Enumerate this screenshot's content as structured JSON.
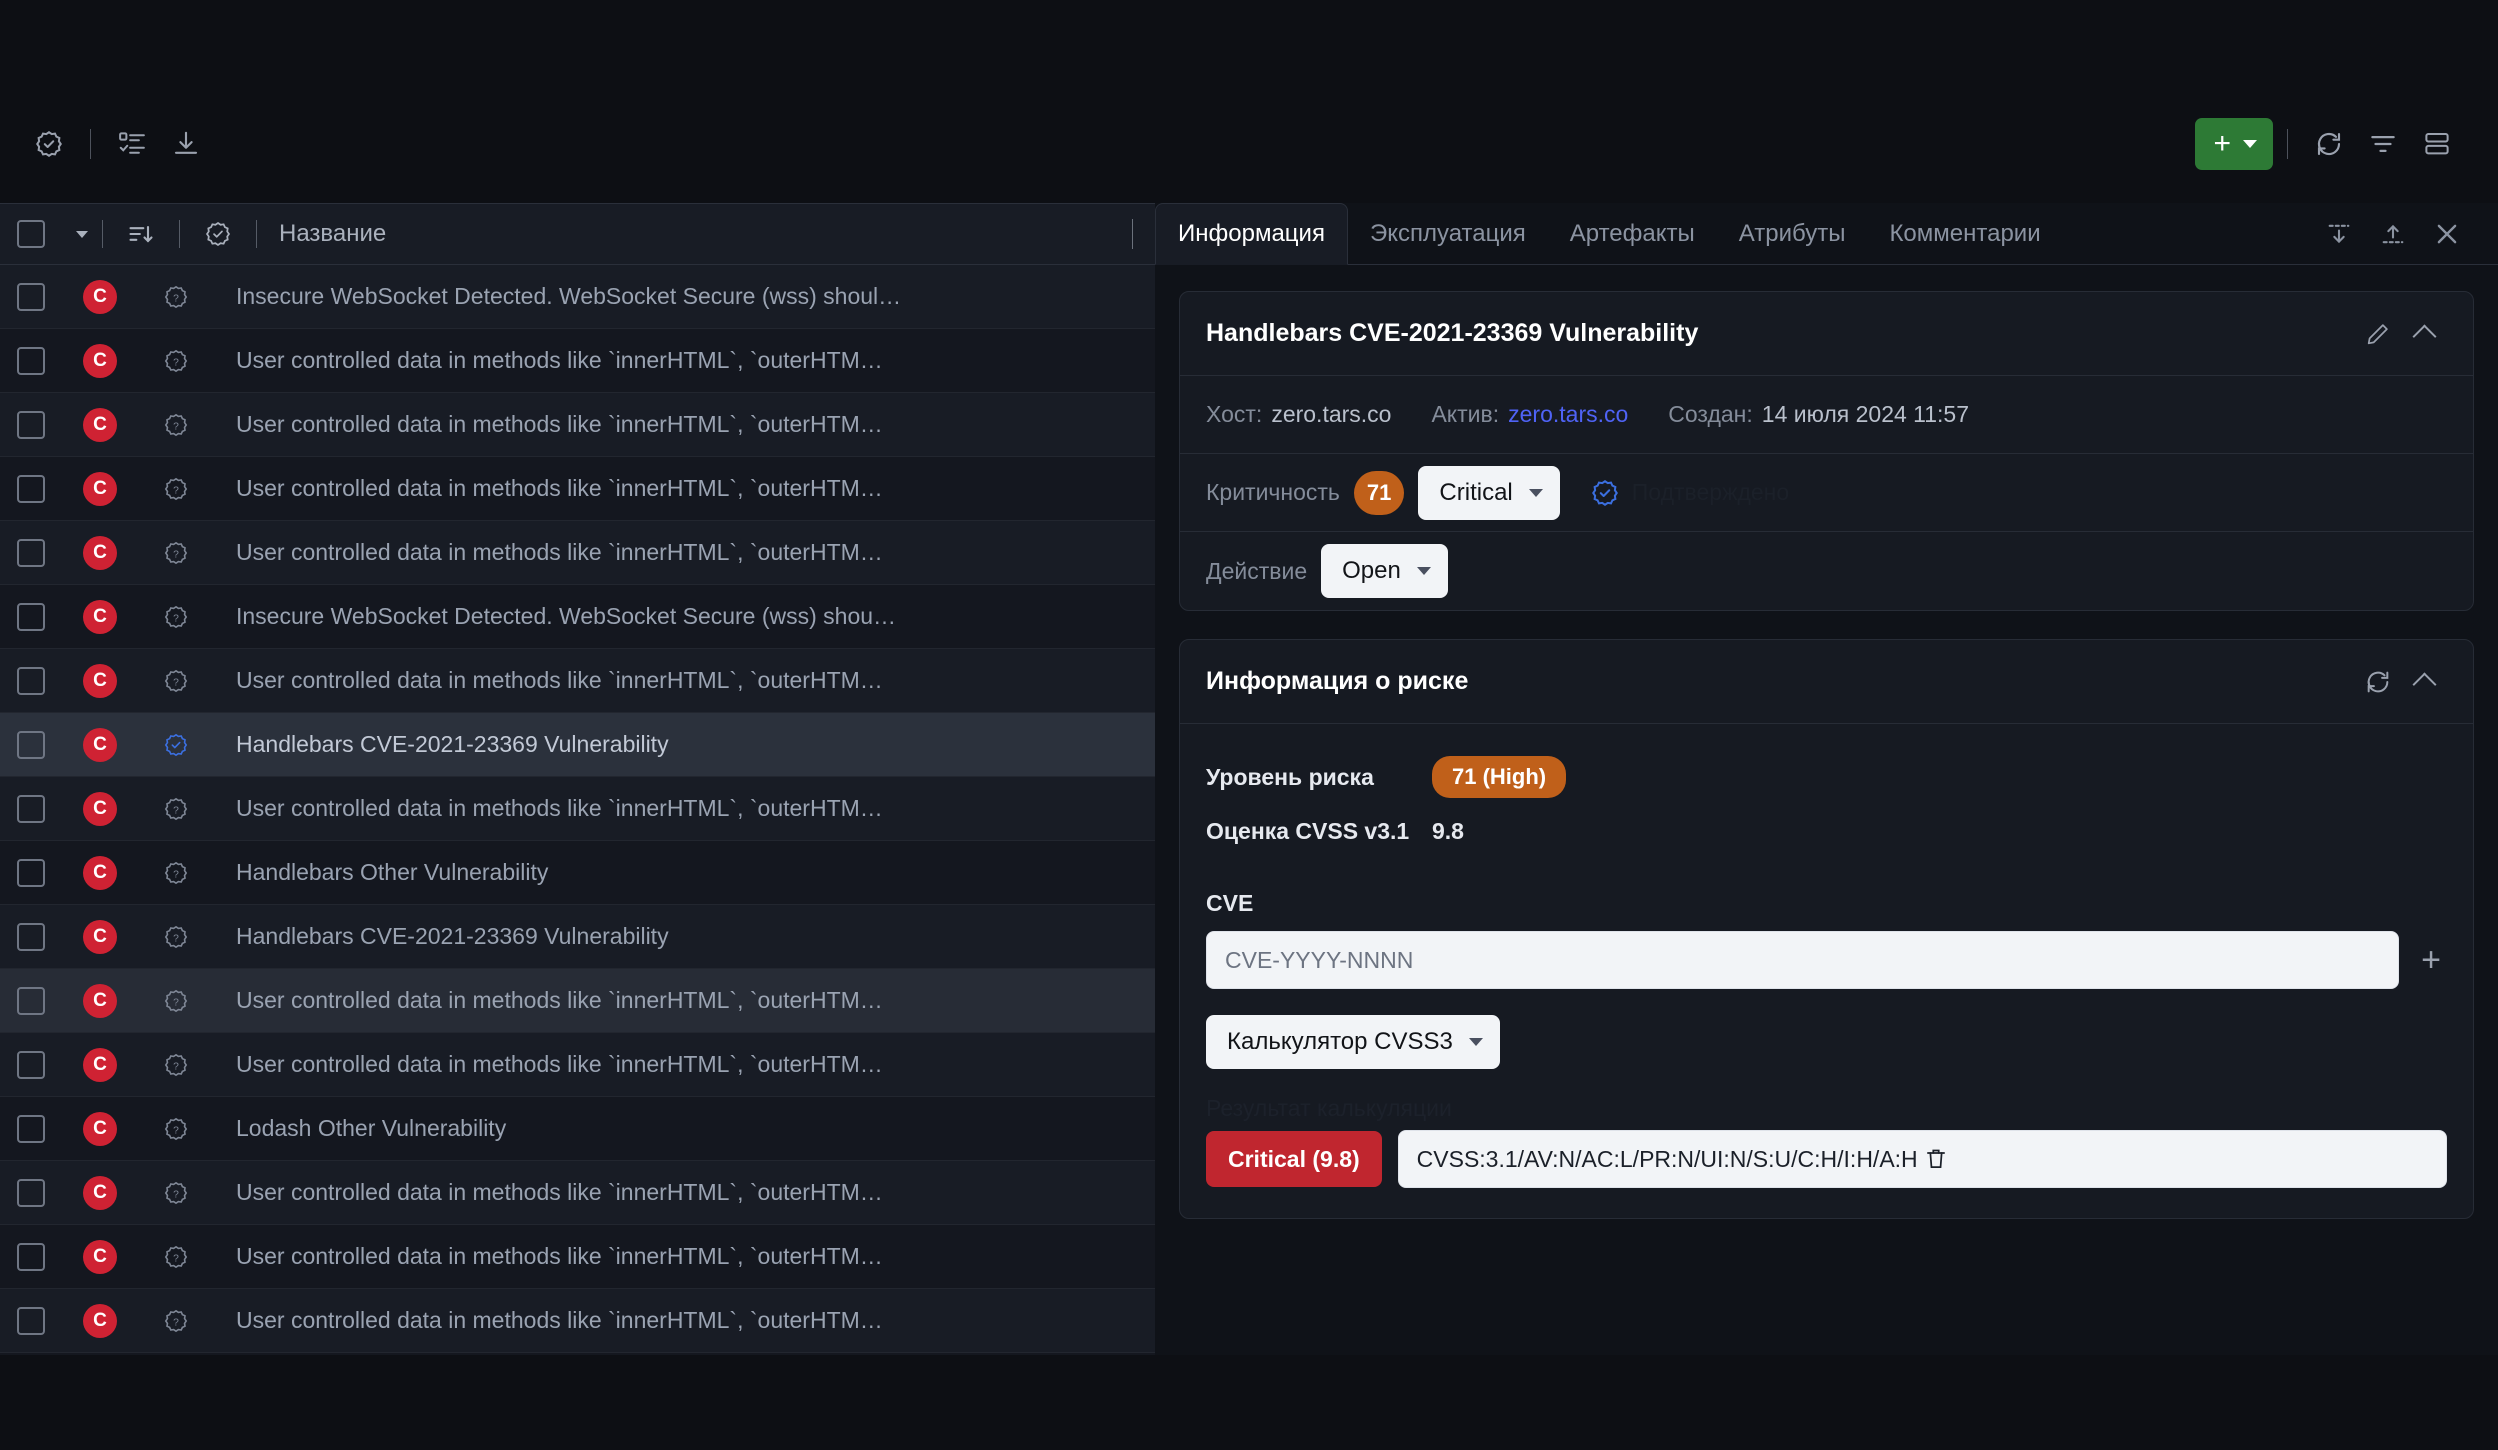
{
  "toolbar": {
    "left_icons": [
      {
        "name": "verified-badge-icon",
        "title": "Подтверждено"
      },
      {
        "name": "checklist-icon",
        "title": "Список"
      },
      {
        "name": "download-icon",
        "title": "Экспорт"
      }
    ],
    "add_label": "+",
    "right_icons": [
      {
        "name": "refresh-icon",
        "title": "Обновить"
      },
      {
        "name": "filter-icon",
        "title": "Фильтр"
      },
      {
        "name": "layout-icon",
        "title": "Вид"
      }
    ]
  },
  "table": {
    "columns": {
      "name": "Название"
    },
    "rows": [
      {
        "severity": "C",
        "status": "unknown",
        "name": "Insecure WebSocket Detected. WebSocket Secure (wss) shoul…",
        "state": "alt"
      },
      {
        "severity": "C",
        "status": "unknown",
        "name": "User controlled data in methods like `innerHTML`, `outerHTM…",
        "state": "normal"
      },
      {
        "severity": "C",
        "status": "unknown",
        "name": "User controlled data in methods like `innerHTML`, `outerHTM…",
        "state": "alt"
      },
      {
        "severity": "C",
        "status": "unknown",
        "name": "User controlled data in methods like `innerHTML`, `outerHTM…",
        "state": "normal"
      },
      {
        "severity": "C",
        "status": "unknown",
        "name": "User controlled data in methods like `innerHTML`, `outerHTM…",
        "state": "alt"
      },
      {
        "severity": "C",
        "status": "unknown",
        "name": "Insecure WebSocket Detected. WebSocket Secure (wss) shou…",
        "state": "normal"
      },
      {
        "severity": "C",
        "status": "unknown",
        "name": "User controlled data in methods like `innerHTML`, `outerHTM…",
        "state": "alt"
      },
      {
        "severity": "C",
        "status": "confirmed",
        "name": "Handlebars CVE-2021-23369 Vulnerability",
        "state": "sel"
      },
      {
        "severity": "C",
        "status": "unknown",
        "name": "User controlled data in methods like `innerHTML`, `outerHTM…",
        "state": "alt"
      },
      {
        "severity": "C",
        "status": "unknown",
        "name": "Handlebars Other Vulnerability",
        "state": "normal"
      },
      {
        "severity": "C",
        "status": "unknown",
        "name": "Handlebars CVE-2021-23369 Vulnerability",
        "state": "alt"
      },
      {
        "severity": "C",
        "status": "unknown",
        "name": "User controlled data in methods like `innerHTML`, `outerHTM…",
        "state": "hl"
      },
      {
        "severity": "C",
        "status": "unknown",
        "name": "User controlled data in methods like `innerHTML`, `outerHTM…",
        "state": "alt"
      },
      {
        "severity": "C",
        "status": "unknown",
        "name": "Lodash Other Vulnerability",
        "state": "normal"
      },
      {
        "severity": "C",
        "status": "unknown",
        "name": "User controlled data in methods like `innerHTML`, `outerHTM…",
        "state": "alt"
      },
      {
        "severity": "C",
        "status": "unknown",
        "name": "User controlled data in methods like `innerHTML`, `outerHTM…",
        "state": "normal"
      },
      {
        "severity": "C",
        "status": "unknown",
        "name": "User controlled data in methods like `innerHTML`, `outerHTM…",
        "state": "alt"
      }
    ]
  },
  "panel": {
    "tabs": [
      {
        "label": "Информация",
        "active": true
      },
      {
        "label": "Эксплуатация",
        "active": false
      },
      {
        "label": "Артефакты",
        "active": false
      },
      {
        "label": "Атрибуты",
        "active": false
      },
      {
        "label": "Комментарии",
        "active": false
      }
    ],
    "tab_icons": [
      {
        "name": "collapse-down-icon"
      },
      {
        "name": "collapse-up-icon"
      },
      {
        "name": "close-icon"
      }
    ],
    "info_card": {
      "title": "Handlebars CVE-2021-23369 Vulnerability",
      "host_label": "Хост:",
      "host_value": "zero.tars.co",
      "asset_label": "Актив:",
      "asset_value": "zero.tars.co",
      "created_label": "Создан:",
      "created_value": "14 июля 2024 11:57",
      "criticality_label": "Критичность",
      "criticality_score": "71",
      "criticality_level": "Critical",
      "confirmed_label": "Подтверждено",
      "action_label": "Действие",
      "action_value": "Open"
    },
    "risk_card": {
      "title": "Информация о риске",
      "risk_level_label": "Уровень риска",
      "risk_level_value": "71 (High)",
      "cvss_label": "Оценка CVSS v3.1",
      "cvss_value": "9.8",
      "cve_label": "CVE",
      "cve_placeholder": "CVE-YYYY-NNNN",
      "cve_value": "",
      "calculator_label": "Калькулятор CVSS3",
      "result_label": "Результат калькуляции",
      "severity_badge": "Critical (9.8)",
      "vector_value": "CVSS:3.1/AV:N/AC:L/PR:N/UI:N/S:U/C:H/I:H/A:H"
    }
  },
  "colors": {
    "accent_green": "#2d7a35",
    "critical_red": "#cf2233",
    "high_orange": "#c0601a",
    "link_blue": "#4f63f5",
    "confirm_blue": "#3b6fe0"
  }
}
